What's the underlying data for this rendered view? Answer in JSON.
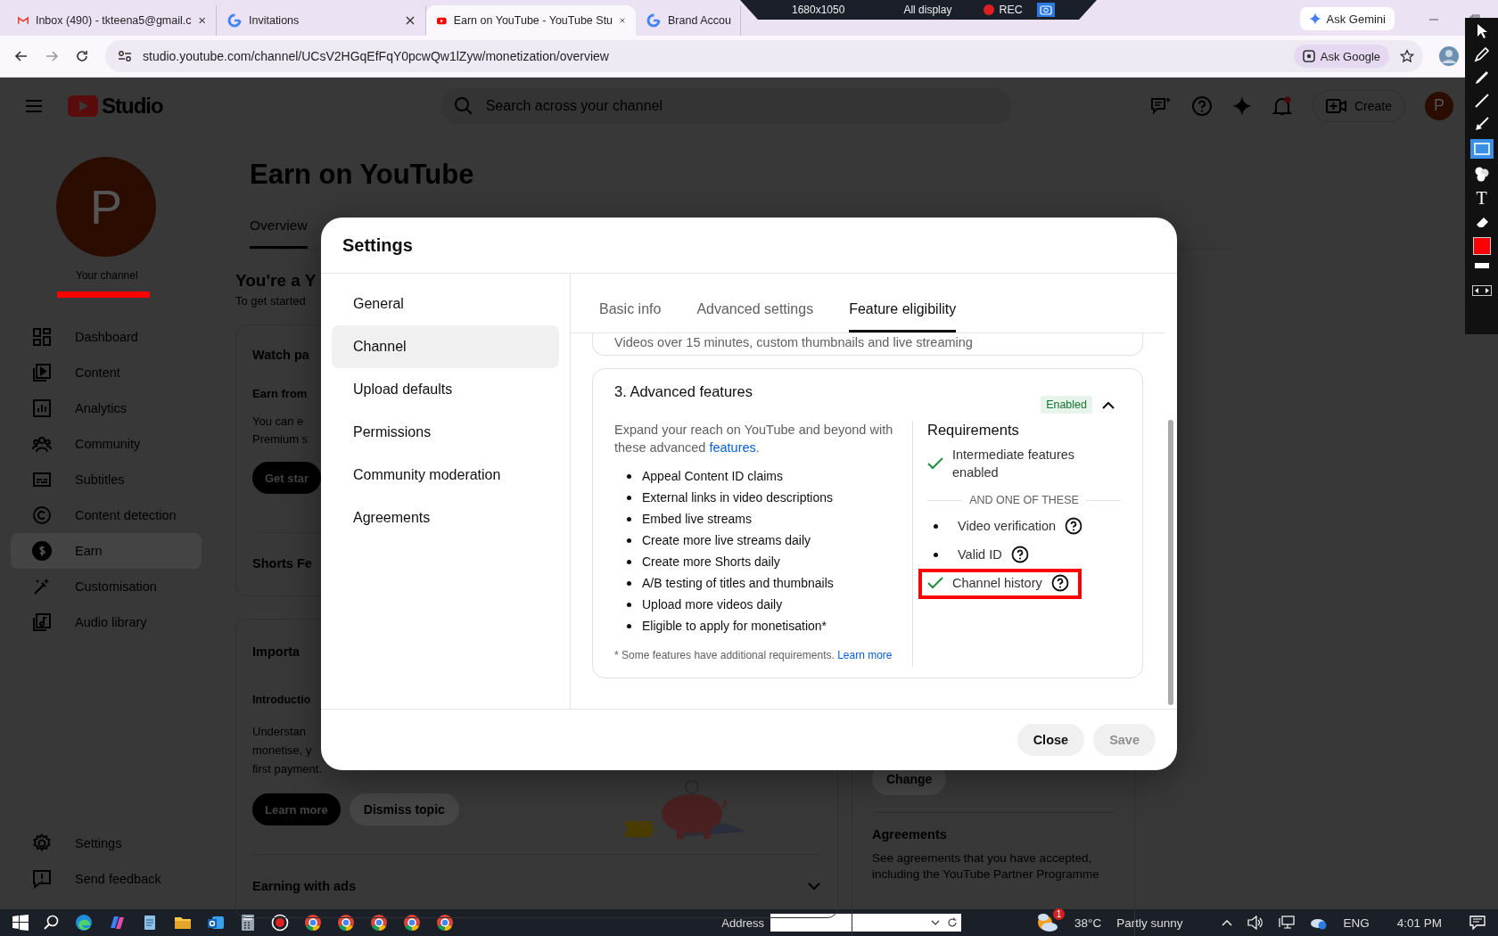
{
  "browser": {
    "tabs": [
      {
        "title": "Inbox (490) - tkteena5@gmail.c",
        "selected": false
      },
      {
        "title": "Invitations",
        "selected": false
      },
      {
        "title": "Earn on YouTube - YouTube Stu",
        "selected": true
      },
      {
        "title": "Brand Accou",
        "selected": false
      }
    ],
    "ask_gemini": "Ask Gemini",
    "url": "studio.youtube.com/channel/UCsV2HGqEfFqY0pcwQw1lZyw/monetization/overview",
    "ask_google": "Ask Google"
  },
  "recorder": {
    "resolution": "1680x1050",
    "mode": "All display",
    "rec": "REC"
  },
  "annotation_tools": {
    "text_tool": "T"
  },
  "studio": {
    "logo_text": "Studio",
    "search_placeholder": "Search across your channel",
    "create": "Create",
    "avatar_letter": "P"
  },
  "sidebar": {
    "avatar_letter": "P",
    "channel_label": "Your channel",
    "items": [
      {
        "label": "Dashboard",
        "selected": false
      },
      {
        "label": "Content",
        "selected": false
      },
      {
        "label": "Analytics",
        "selected": false
      },
      {
        "label": "Community",
        "selected": false
      },
      {
        "label": "Subtitles",
        "selected": false
      },
      {
        "label": "Content detection",
        "selected": false
      },
      {
        "label": "Earn",
        "selected": true
      },
      {
        "label": "Customisation",
        "selected": false
      },
      {
        "label": "Audio library",
        "selected": false
      }
    ],
    "footer_items": [
      {
        "label": "Settings"
      },
      {
        "label": "Send feedback"
      }
    ]
  },
  "page": {
    "title": "Earn on YouTube",
    "tabs": [
      {
        "label": "Overview",
        "selected": true
      }
    ],
    "heading": "You're a Y",
    "subheading": "To get started",
    "watch_card": {
      "title": "Watch pa",
      "subtitle": "Earn from",
      "body": [
        "You can e",
        "Premium s"
      ],
      "button": "Get star",
      "section_title": "Shorts Fe"
    },
    "important_card": {
      "title": "Importa",
      "subtitle": "Introductio",
      "body": [
        "Understan",
        "monetise, y",
        "first payment."
      ],
      "primary_button": "Learn more",
      "secondary_button": "Dismiss topic",
      "row": "Earning with ads"
    },
    "side_card": {
      "button": "Change",
      "heading": "Agreements",
      "body": "See agreements that you have accepted, including the YouTube Partner Programme"
    }
  },
  "dialog": {
    "title": "Settings",
    "nav": [
      {
        "label": "General",
        "selected": false
      },
      {
        "label": "Channel",
        "selected": true
      },
      {
        "label": "Upload defaults",
        "selected": false
      },
      {
        "label": "Permissions",
        "selected": false
      },
      {
        "label": "Community moderation",
        "selected": false
      },
      {
        "label": "Agreements",
        "selected": false
      }
    ],
    "tabs": [
      {
        "label": "Basic info",
        "selected": false
      },
      {
        "label": "Advanced settings",
        "selected": false
      },
      {
        "label": "Feature eligibility",
        "selected": true
      }
    ],
    "previous_card_text": "Videos over 15 minutes, custom thumbnails and live streaming",
    "feature_card": {
      "title": "3. Advanced features",
      "status": "Enabled",
      "expanded": true,
      "description": "Expand your reach on YouTube and beyond with these advanced ",
      "description_link": "features",
      "description_end": ".",
      "features": [
        "Appeal Content ID claims",
        "External links in video descriptions",
        "Embed live streams",
        "Create more live streams daily",
        "Create more Shorts daily",
        "A/B testing of titles and thumbnails",
        "Upload more videos daily",
        "Eligible to apply for monetisation*"
      ],
      "footnote": "* Some features have additional requirements. ",
      "footnote_link": "Learn more",
      "requirements_title": "Requirements",
      "requirements": [
        {
          "kind": "check",
          "label": "Intermediate features enabled",
          "help": false,
          "highlighted": false
        },
        {
          "kind": "divider",
          "label": "AND ONE OF THESE"
        },
        {
          "kind": "bullet",
          "label": "Video verification",
          "help": true,
          "highlighted": false
        },
        {
          "kind": "bullet",
          "label": "Valid ID",
          "help": true,
          "highlighted": false
        },
        {
          "kind": "check",
          "label": "Channel history",
          "help": true,
          "highlighted": true
        }
      ]
    },
    "buttons": [
      {
        "label": "Close",
        "disabled": false
      },
      {
        "label": "Save",
        "disabled": true
      }
    ]
  },
  "taskbar": {
    "address_label": "Address",
    "weather_badge": "1",
    "temperature": "38°C",
    "weather": "Partly sunny",
    "language": "ENG",
    "time": "4:01 PM"
  }
}
